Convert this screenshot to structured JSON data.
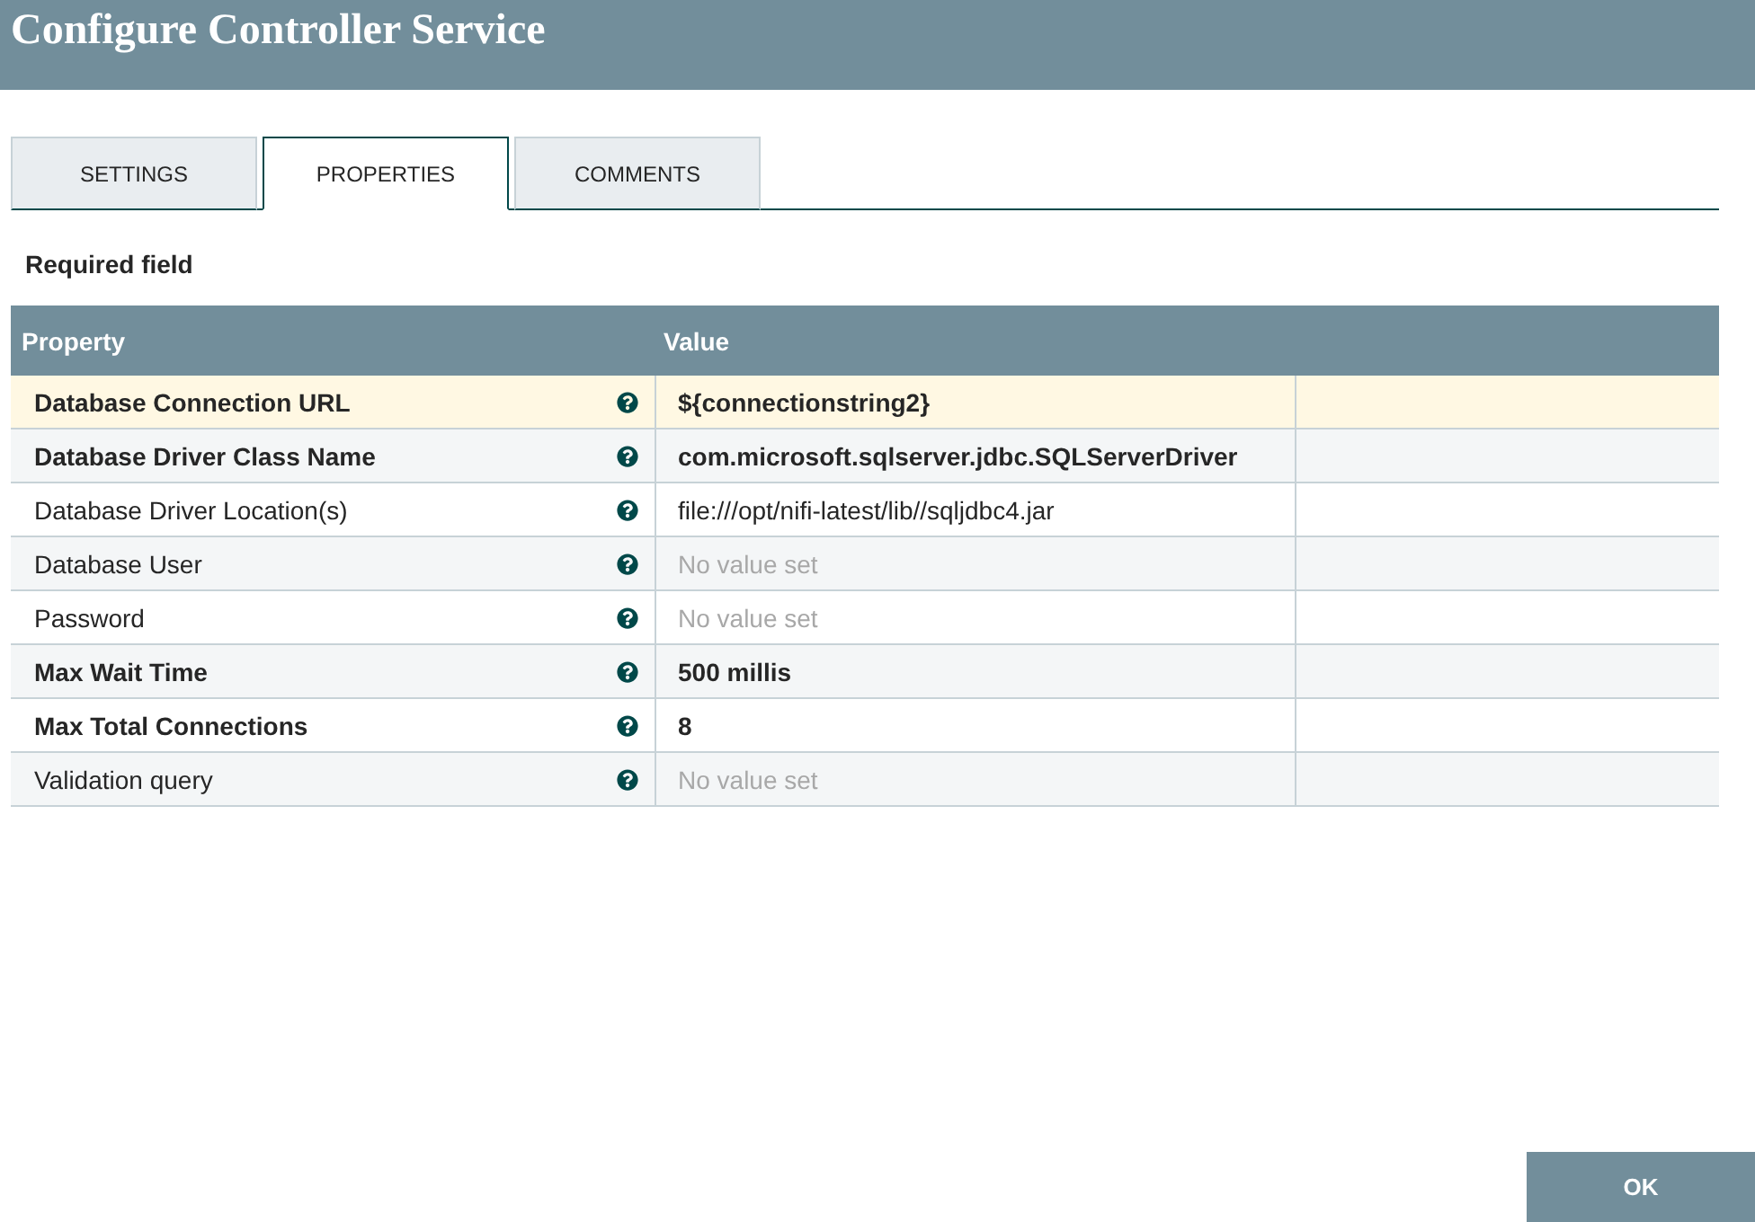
{
  "dialog": {
    "title": "Configure Controller Service"
  },
  "tabs": [
    {
      "label": "SETTINGS",
      "selected": false
    },
    {
      "label": "PROPERTIES",
      "selected": true
    },
    {
      "label": "COMMENTS",
      "selected": false
    }
  ],
  "required_note": "Required field",
  "table": {
    "columns": [
      "Property",
      "Value"
    ],
    "rows": [
      {
        "property": "Database Connection URL",
        "required": true,
        "value": "${connectionstring2}",
        "value_set": true,
        "selected": true
      },
      {
        "property": "Database Driver Class Name",
        "required": true,
        "value": "com.microsoft.sqlserver.jdbc.SQLServerDriver",
        "value_set": true,
        "selected": false
      },
      {
        "property": "Database Driver Location(s)",
        "required": false,
        "value": "file:///opt/nifi-latest/lib//sqljdbc4.jar",
        "value_set": true,
        "selected": false
      },
      {
        "property": "Database User",
        "required": false,
        "value": "No value set",
        "value_set": false,
        "selected": false
      },
      {
        "property": "Password",
        "required": false,
        "value": "No value set",
        "value_set": false,
        "selected": false
      },
      {
        "property": "Max Wait Time",
        "required": true,
        "value": "500 millis",
        "value_set": true,
        "selected": false
      },
      {
        "property": "Max Total Connections",
        "required": true,
        "value": "8",
        "value_set": true,
        "selected": false
      },
      {
        "property": "Validation query",
        "required": false,
        "value": "No value set",
        "value_set": false,
        "selected": false
      }
    ]
  },
  "buttons": [
    {
      "label": "OK"
    }
  ]
}
